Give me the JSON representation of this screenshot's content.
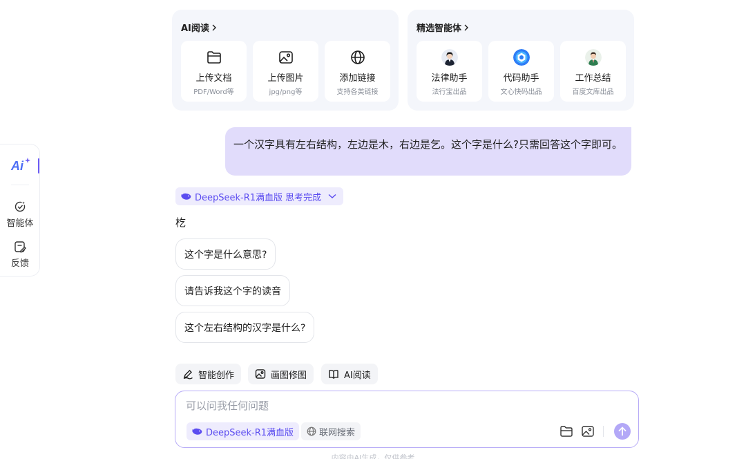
{
  "rail": {
    "items": [
      {
        "label": "智能体",
        "icon": "agent-icon"
      },
      {
        "label": "反馈",
        "icon": "feedback-icon"
      }
    ]
  },
  "ai_reading": {
    "title": "AI阅读",
    "tiles": [
      {
        "label": "上传文档",
        "sub": "PDF/Word等",
        "icon": "folder-icon"
      },
      {
        "label": "上传图片",
        "sub": "jpg/png等",
        "icon": "image-icon"
      },
      {
        "label": "添加链接",
        "sub": "支持各类链接",
        "icon": "globe-icon"
      }
    ]
  },
  "agents": {
    "title": "精选智能体",
    "tiles": [
      {
        "label": "法律助手",
        "sub": "法行宝出品",
        "icon": "lawyer-avatar"
      },
      {
        "label": "代码助手",
        "sub": "文心快码出品",
        "icon": "code-assistant-logo"
      },
      {
        "label": "工作总结",
        "sub": "百度文库出品",
        "icon": "worker-avatar"
      }
    ]
  },
  "conversation": {
    "user_message": "一个汉字具有左右结构，左边是木，右边是乞。这个字是什么?只需回答这个字即可。",
    "model_tag": {
      "model": "DeepSeek-R1满血版",
      "status": "思考完成"
    },
    "answer": "杚",
    "suggestions": [
      "这个字是什么意思?",
      "请告诉我这个字的读音",
      "这个左右结构的汉字是什么?"
    ]
  },
  "tools": [
    {
      "label": "智能创作",
      "icon": "pen-icon"
    },
    {
      "label": "画图修图",
      "icon": "picture-icon"
    },
    {
      "label": "AI阅读",
      "icon": "book-icon"
    }
  ],
  "input": {
    "placeholder": "可以问我任何问题",
    "model_chip": "DeepSeek-R1满血版",
    "web_chip": "联网搜索"
  },
  "footer": "内容由AI生成，仅供参考",
  "colors": {
    "accent": "#5b4cf0",
    "user_bubble": "#e1dcfb",
    "card_bg": "#f4f6fb",
    "send_button": "#b3a8f7"
  }
}
